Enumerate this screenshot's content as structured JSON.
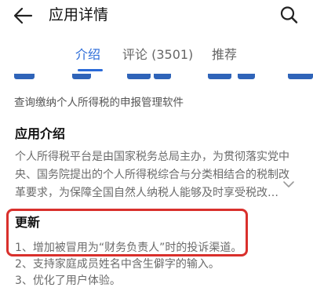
{
  "header": {
    "title": "应用详情",
    "back_icon": "arrow-left-icon",
    "search_icon": "search-icon"
  },
  "tabs": [
    {
      "label": "介绍",
      "active": true
    },
    {
      "label": "评论 (3501)",
      "active": false
    },
    {
      "label": "推荐",
      "active": false
    }
  ],
  "colors": {
    "accent": "#2a6ad8",
    "highlight_border": "#d9302c"
  },
  "summary": "查询缴纳个人所得税的申报管理软件",
  "intro": {
    "title": "应用介绍",
    "lines": [
      "个人所得税平台是由国家税务总局主办，为贯彻落实党中",
      "央、国务院提出的个人所得税综合与分类相结合的税制改",
      "革要求，为保障全国自然人纳税人能够及时享受税改…"
    ],
    "expand_icon": "chevron-down-icon"
  },
  "update": {
    "title": "更新",
    "items": [
      "1、增加被冒用为“财务负责人”时的投诉渠道。",
      "2、支持家庭成员姓名中含生僻字的输入。",
      "3、优化了用户体验。"
    ]
  }
}
